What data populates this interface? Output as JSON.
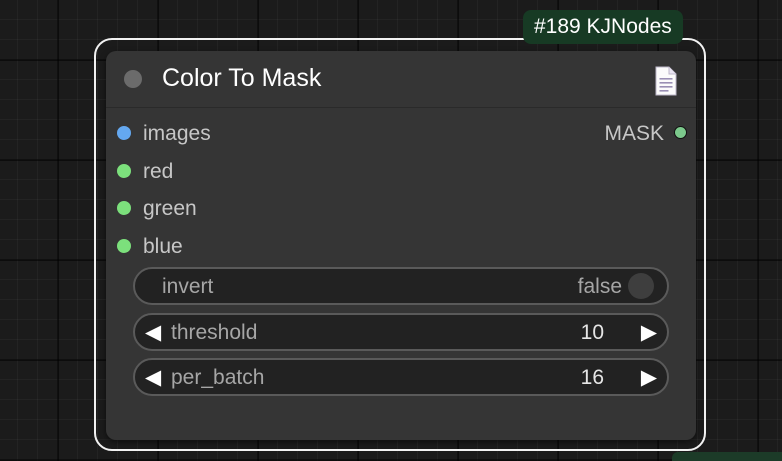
{
  "node": {
    "id_badge": "#189 KJNodes",
    "title": "Color To Mask"
  },
  "inputs": [
    {
      "label": "images",
      "color": "#64a8f0"
    },
    {
      "label": "red",
      "color": "#7ce07c"
    },
    {
      "label": "green",
      "color": "#7ce07c"
    },
    {
      "label": "blue",
      "color": "#7ce07c"
    }
  ],
  "outputs": [
    {
      "label": "MASK",
      "color": "#7cc98c"
    }
  ],
  "widgets": {
    "invert": {
      "label": "invert",
      "value": "false"
    },
    "threshold": {
      "label": "threshold",
      "value": "10"
    },
    "per_batch": {
      "label": "per_batch",
      "value": "16"
    },
    "arrow_left": "◀",
    "arrow_right": "▶"
  },
  "icons": {
    "collapse": "collapse-dot-icon",
    "help": "document-icon"
  },
  "colors": {
    "node_body": "#353535",
    "badge_bg": "#173a24",
    "selection": "#f2f2f2",
    "canvas": "#1b1b1b"
  }
}
